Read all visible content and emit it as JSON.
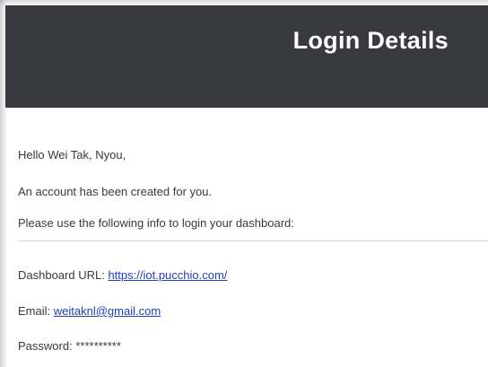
{
  "header": {
    "title": "Login Details"
  },
  "greeting": {
    "text": "Hello Wei Tak, Nyou,"
  },
  "messages": {
    "account_created": "An account has been created for you.",
    "instructions": "Please use the following info to login your dashboard:"
  },
  "details": {
    "dashboard_label": "Dashboard URL:",
    "dashboard_url": "https://iot.pucchio.com/",
    "email_label": "Email:",
    "email_value": "weitaknl@gmail.com",
    "password_label": "Password:",
    "password_value": "**********"
  },
  "colors": {
    "header_bg": "#393940",
    "link": "#1f3fbf"
  }
}
